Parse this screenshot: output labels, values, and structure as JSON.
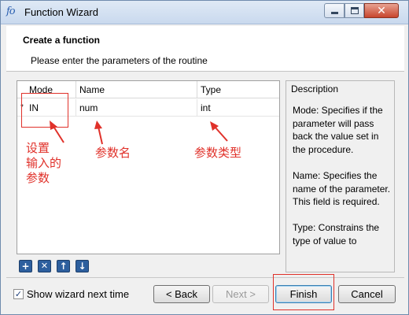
{
  "window": {
    "title": "Function Wizard",
    "icon_text": "fo",
    "controls": {
      "minimize": "minimize",
      "maximize": "maximize",
      "close": "✕"
    }
  },
  "header": {
    "title": "Create a function",
    "subtitle": "Please enter the parameters of the routine"
  },
  "table": {
    "columns": [
      "Mode",
      "Name",
      "Type"
    ],
    "rows": [
      {
        "marker": "*",
        "mode": "IN",
        "name": "num",
        "type": "int"
      }
    ]
  },
  "description": {
    "title": "Description",
    "text": "Mode: Specifies if the parameter will pass back the value set in the procedure.\n\nName: Specifies the name of the parameter. This field is required.\n\nType: Constrains the type of value to"
  },
  "toolbar": {
    "add": "+",
    "remove": "✕",
    "move_up": "↑",
    "move_down": "↓"
  },
  "footer": {
    "show_wizard_label": "Show wizard next time",
    "show_wizard_checked": true,
    "back_label": "< Back",
    "next_label": "Next >",
    "finish_label": "Finish",
    "cancel_label": "Cancel"
  },
  "annotations": {
    "mode_note": "设置\n输入的\n参数",
    "name_note": "参数名",
    "type_note": "参数类型",
    "color": "#e0312a"
  }
}
